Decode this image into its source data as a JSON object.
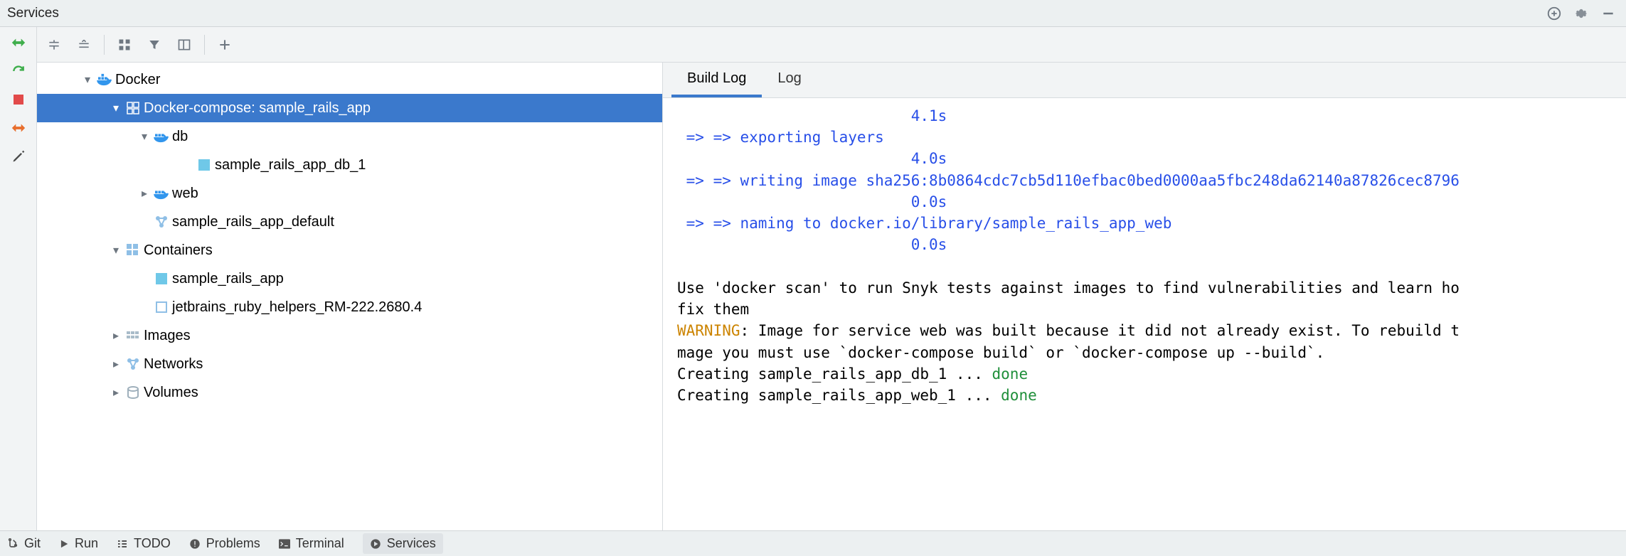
{
  "panel_title": "Services",
  "tree": {
    "root": {
      "label": "Docker"
    },
    "compose": {
      "label": "Docker-compose: sample_rails_app"
    },
    "db": {
      "label": "db"
    },
    "db_container": {
      "label": "sample_rails_app_db_1"
    },
    "web": {
      "label": "web"
    },
    "network_default": {
      "label": "sample_rails_app_default"
    },
    "containers": {
      "label": "Containers"
    },
    "cont_app": {
      "label": "sample_rails_app"
    },
    "cont_helpers": {
      "label": "jetbrains_ruby_helpers_RM-222.2680.4"
    },
    "images": {
      "label": "Images"
    },
    "networks": {
      "label": "Networks"
    },
    "volumes": {
      "label": "Volumes"
    }
  },
  "tabs": {
    "build_log": "Build Log",
    "log": "Log"
  },
  "console": {
    "l1_time": "                          4.1s",
    "l2": " => => exporting layers",
    "l3_time": "                          4.0s",
    "l4": " => => writing image sha256:8b0864cdc7cb5d110efbac0bed0000aa5fbc248da62140a87826cec8796",
    "l5_time": "                          0.0s",
    "l6": " => => naming to docker.io/library/sample_rails_app_web",
    "l7_time": "                          0.0s",
    "blank": "",
    "scan1": "Use 'docker scan' to run Snyk tests against images to find vulnerabilities and learn ho",
    "scan2": "fix them",
    "warn_label": "WARNING",
    "warn_rest": ": Image for service web was built because it did not already exist. To rebuild t",
    "warn_line2": "mage you must use `docker-compose build` or `docker-compose up --build`.",
    "create1_a": "Creating sample_rails_app_db_1 ... ",
    "create1_b": "done",
    "create2_a": "Creating sample_rails_app_web_1 ... ",
    "create2_b": "done"
  },
  "statusbar": {
    "git": "Git",
    "run": "Run",
    "todo": "TODO",
    "problems": "Problems",
    "terminal": "Terminal",
    "services": "Services"
  }
}
